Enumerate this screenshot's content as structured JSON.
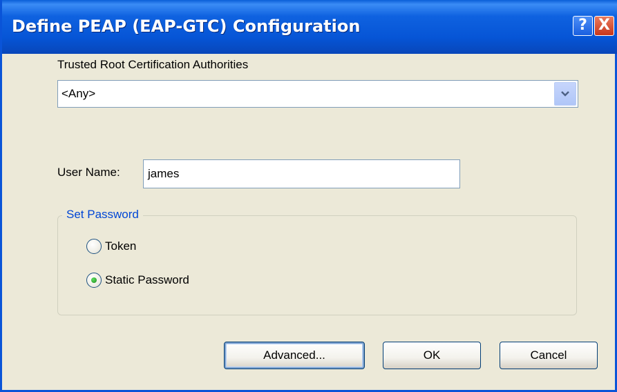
{
  "window": {
    "title": "Define PEAP (EAP-GTC) Configuration",
    "help_glyph": "?",
    "close_glyph": "X"
  },
  "trusted_root": {
    "label": "Trusted Root Certification Authorities",
    "selected": "<Any>"
  },
  "user": {
    "label": "User Name:",
    "value": "james"
  },
  "password_group": {
    "legend": "Set Password",
    "options": [
      {
        "label": "Token",
        "checked": false
      },
      {
        "label": "Static Password",
        "checked": true
      }
    ]
  },
  "buttons": {
    "advanced": "Advanced...",
    "ok": "OK",
    "cancel": "Cancel"
  },
  "colors": {
    "title_bar": "#0655d6",
    "group_legend": "#0046d5",
    "dialog_bg": "#ece9d8"
  }
}
